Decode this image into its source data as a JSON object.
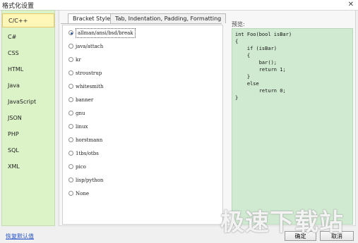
{
  "window": {
    "title": "格式化设置",
    "close_glyph": "✕"
  },
  "sidebar": {
    "items": [
      {
        "label": "C/C++",
        "active": true
      },
      {
        "label": "C#"
      },
      {
        "label": "CSS"
      },
      {
        "label": "HTML"
      },
      {
        "label": "Java"
      },
      {
        "label": "JavaScript"
      },
      {
        "label": "JSON"
      },
      {
        "label": "PHP"
      },
      {
        "label": "SQL"
      },
      {
        "label": "XML"
      }
    ]
  },
  "tabs": [
    {
      "label": "Bracket Style",
      "active": true
    },
    {
      "label": "Tab, Indentation, Padding, Formatting"
    }
  ],
  "bracket_styles": [
    {
      "label": "allman/ansi/bsd/break",
      "selected": true
    },
    {
      "label": "java/attach"
    },
    {
      "label": "kr"
    },
    {
      "label": "stroustrup"
    },
    {
      "label": "whitesmith"
    },
    {
      "label": "banner"
    },
    {
      "label": "gnu"
    },
    {
      "label": "linux"
    },
    {
      "label": "horstmann"
    },
    {
      "label": "1tbs/otbs"
    },
    {
      "label": "pico"
    },
    {
      "label": "lisp/python"
    },
    {
      "label": "None"
    }
  ],
  "preview": {
    "label": "预览:",
    "code": "int Foo(bool isBar)\n{\n    if (isBar)\n    {\n        bar();\n        return 1;\n    }\n    else\n        return 0;\n}"
  },
  "footer": {
    "restore_defaults": "恢复默认值",
    "ok": "确定",
    "cancel": "取消"
  },
  "watermark": "极速下载站"
}
